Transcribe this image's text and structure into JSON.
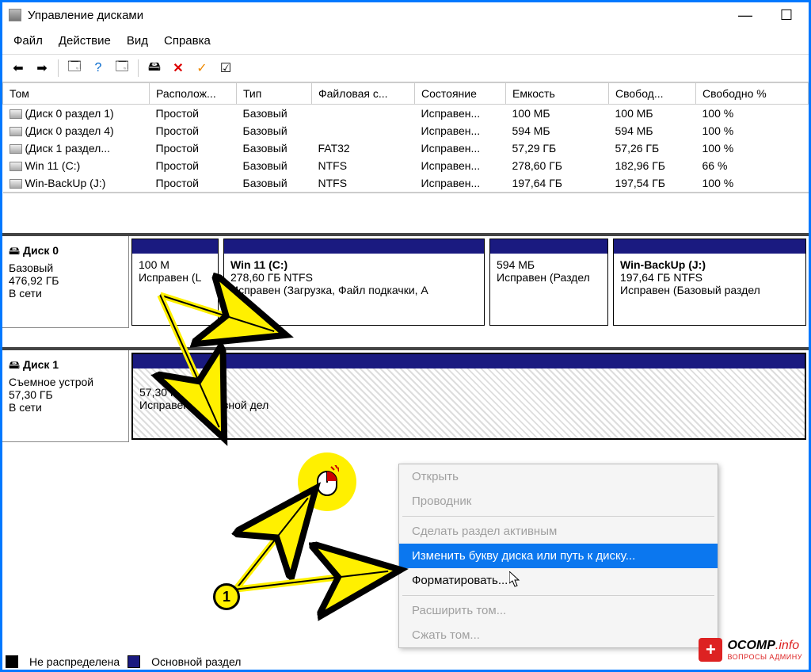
{
  "window": {
    "title": "Управление дисками"
  },
  "menu": [
    "Файл",
    "Действие",
    "Вид",
    "Справка"
  ],
  "columns": [
    "Том",
    "Располож...",
    "Тип",
    "Файловая с...",
    "Состояние",
    "Емкость",
    "Свобод...",
    "Свободно %"
  ],
  "volumes": [
    {
      "name": "(Диск 0 раздел 1)",
      "loc": "Простой",
      "type": "Базовый",
      "fs": "",
      "state": "Исправен...",
      "cap": "100 МБ",
      "free": "100 МБ",
      "pct": "100 %"
    },
    {
      "name": "(Диск 0 раздел 4)",
      "loc": "Простой",
      "type": "Базовый",
      "fs": "",
      "state": "Исправен...",
      "cap": "594 МБ",
      "free": "594 МБ",
      "pct": "100 %"
    },
    {
      "name": "(Диск 1 раздел...",
      "loc": "Простой",
      "type": "Базовый",
      "fs": "FAT32",
      "state": "Исправен...",
      "cap": "57,29 ГБ",
      "free": "57,26 ГБ",
      "pct": "100 %"
    },
    {
      "name": "Win 11 (C:)",
      "loc": "Простой",
      "type": "Базовый",
      "fs": "NTFS",
      "state": "Исправен...",
      "cap": "278,60 ГБ",
      "free": "182,96 ГБ",
      "pct": "66 %"
    },
    {
      "name": "Win-BackUp (J:)",
      "loc": "Простой",
      "type": "Базовый",
      "fs": "NTFS",
      "state": "Исправен...",
      "cap": "197,64 ГБ",
      "free": "197,54 ГБ",
      "pct": "100 %"
    }
  ],
  "disks": {
    "d0": {
      "label": "Диск 0",
      "type": "Базовый",
      "size": "476,92 ГБ",
      "state": "В сети",
      "parts": [
        {
          "title": "",
          "line1": "100 М",
          "line2": "Исправен (L"
        },
        {
          "title": "Win 11  (C:)",
          "line1": "278,60 ГБ NTFS",
          "line2": "Исправен (Загрузка, Файл подкачки, А"
        },
        {
          "title": "",
          "line1": "594 МБ",
          "line2": "Исправен (Раздел"
        },
        {
          "title": "Win-BackUp  (J:)",
          "line1": "197,64 ГБ NTFS",
          "line2": "Исправен (Базовый раздел"
        }
      ]
    },
    "d1": {
      "label": "Диск 1",
      "type": "Съемное устрой",
      "size": "57,30 ГБ",
      "state": "В сети",
      "parts": [
        {
          "title": "",
          "line1": "57,30 ГБ FAT32",
          "line2": "Исправен (Основной       дел"
        }
      ]
    }
  },
  "legend": {
    "unalloc": "Не распределена",
    "primary": "Основной раздел"
  },
  "contextMenu": {
    "open": "Открыть",
    "explorer": "Проводник",
    "active": "Сделать раздел активным",
    "change_letter": "Изменить букву диска или путь к диску...",
    "format": "Форматировать...",
    "extend": "Расширить том...",
    "shrink": "Сжать том..."
  },
  "annotation": {
    "badge": "1"
  },
  "watermark": {
    "brand": "OCOMP",
    "suffix": ".info",
    "sub": "ВОПРОСЫ АДМИНУ"
  }
}
